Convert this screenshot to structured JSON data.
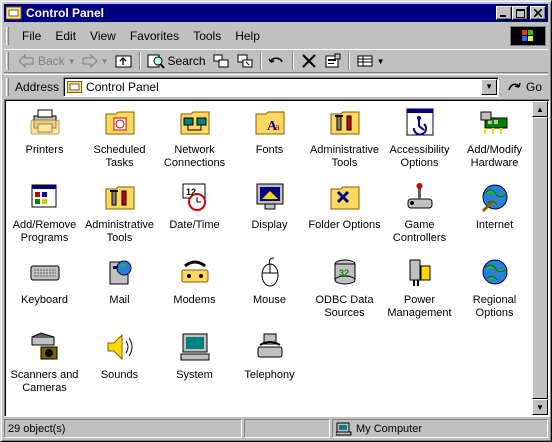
{
  "window": {
    "title": "Control Panel"
  },
  "menu": [
    "File",
    "Edit",
    "View",
    "Favorites",
    "Tools",
    "Help"
  ],
  "toolbar": {
    "back": "Back",
    "forward": "",
    "search": "Search"
  },
  "address": {
    "label": "Address",
    "value": "Control Panel",
    "go": "Go"
  },
  "items": [
    {
      "label": "Printers",
      "icon": "printers-icon"
    },
    {
      "label": "Scheduled Tasks",
      "icon": "scheduled-tasks-icon"
    },
    {
      "label": "Network Connections",
      "icon": "network-connections-icon"
    },
    {
      "label": "Fonts",
      "icon": "fonts-icon"
    },
    {
      "label": "Administrative Tools",
      "icon": "administrative-tools-icon"
    },
    {
      "label": "Accessibility Options",
      "icon": "accessibility-options-icon"
    },
    {
      "label": "Add/Modify Hardware",
      "icon": "add-modify-hardware-icon"
    },
    {
      "label": "Add/Remove Programs",
      "icon": "add-remove-programs-icon"
    },
    {
      "label": "Administrative Tools",
      "icon": "administrative-tools-icon"
    },
    {
      "label": "Date/Time",
      "icon": "date-time-icon"
    },
    {
      "label": "Display",
      "icon": "display-icon"
    },
    {
      "label": "Folder Options",
      "icon": "folder-options-icon"
    },
    {
      "label": "Game Controllers",
      "icon": "game-controllers-icon"
    },
    {
      "label": "Internet",
      "icon": "internet-icon"
    },
    {
      "label": "Keyboard",
      "icon": "keyboard-icon"
    },
    {
      "label": "Mail",
      "icon": "mail-icon"
    },
    {
      "label": "Modems",
      "icon": "modems-icon"
    },
    {
      "label": "Mouse",
      "icon": "mouse-icon"
    },
    {
      "label": "ODBC Data Sources",
      "icon": "odbc-data-sources-icon"
    },
    {
      "label": "Power Management",
      "icon": "power-management-icon"
    },
    {
      "label": "Regional Options",
      "icon": "regional-options-icon"
    },
    {
      "label": "Scanners and Cameras",
      "icon": "scanners-cameras-icon"
    },
    {
      "label": "Sounds",
      "icon": "sounds-icon"
    },
    {
      "label": "System",
      "icon": "system-icon"
    },
    {
      "label": "Telephony",
      "icon": "telephony-icon"
    }
  ],
  "status": {
    "count": "29 object(s)",
    "location": "My Computer"
  },
  "colors": {
    "titlebar": "#000080",
    "face": "#c0c0c0",
    "content": "#ffffff"
  }
}
